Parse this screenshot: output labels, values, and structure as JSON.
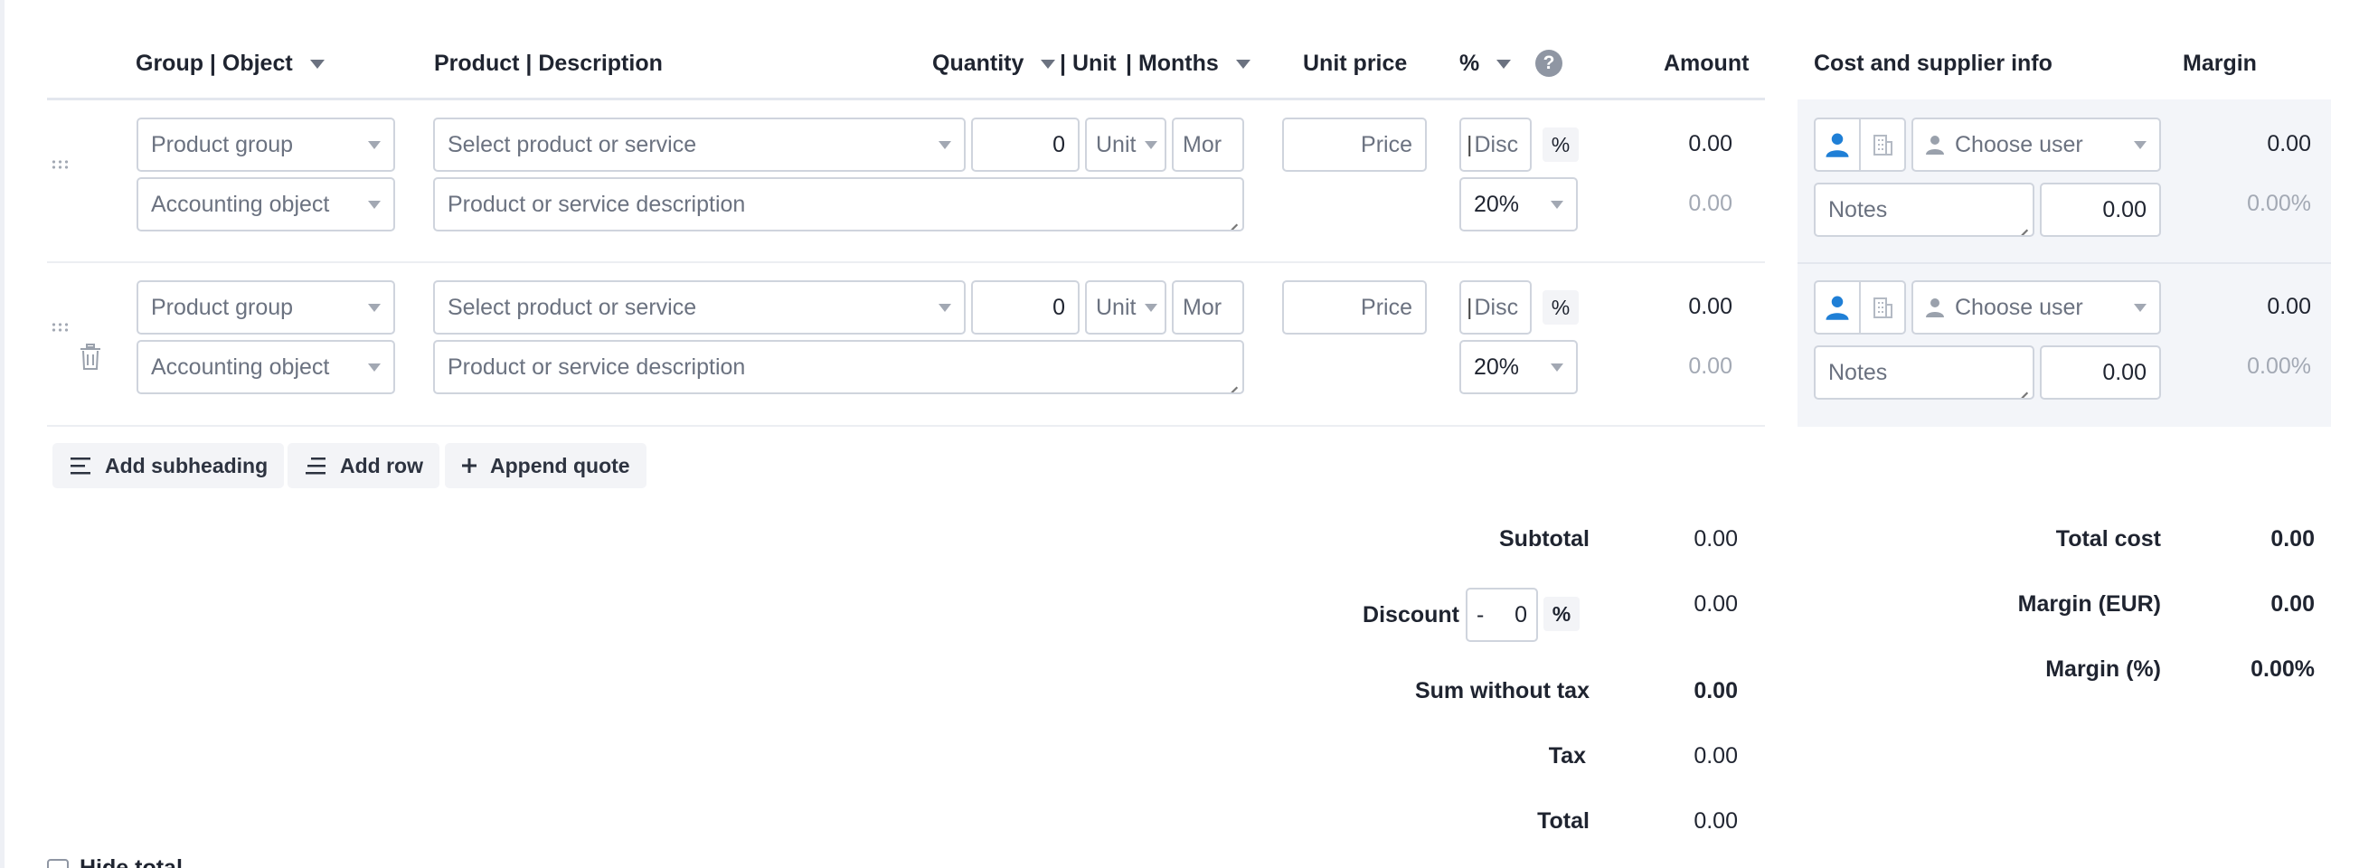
{
  "header": {
    "group_object": "Group | Object",
    "product_description": "Product | Description",
    "quantity": "Quantity",
    "unit": "| Unit",
    "months": "| Months",
    "unit_price": "Unit price",
    "percent": "%",
    "help_glyph": "?",
    "amount": "Amount",
    "cost_supplier": "Cost and supplier info",
    "margin": "Margin"
  },
  "rows": [
    {
      "product_group_placeholder": "Product group",
      "accounting_object_placeholder": "Accounting object",
      "product_placeholder": "Select product or service",
      "description_placeholder": "Product or service description",
      "quantity_value": "0",
      "unit_placeholder": "Unit",
      "months_placeholder": "Mor",
      "price_placeholder": "Price",
      "discount_placeholder": "Disc",
      "percent_button": "%",
      "tax_value": "20%",
      "amount": "0.00",
      "amount_tax": "0.00",
      "user_placeholder": "Choose user",
      "notes_placeholder": "Notes",
      "cost_value": "0.00",
      "margin": "0.00",
      "margin_pct": "0.00%"
    },
    {
      "product_group_placeholder": "Product group",
      "accounting_object_placeholder": "Accounting object",
      "product_placeholder": "Select product or service",
      "description_placeholder": "Product or service description",
      "quantity_value": "0",
      "unit_placeholder": "Unit",
      "months_placeholder": "Mor",
      "price_placeholder": "Price",
      "discount_placeholder": "Disc",
      "percent_button": "%",
      "tax_value": "20%",
      "amount": "0.00",
      "amount_tax": "0.00",
      "user_placeholder": "Choose user",
      "notes_placeholder": "Notes",
      "cost_value": "0.00",
      "margin": "0.00",
      "margin_pct": "0.00%"
    }
  ],
  "actions": {
    "add_subheading": "Add subheading",
    "add_row": "Add row",
    "append_quote": "Append quote"
  },
  "totals": {
    "subtotal_label": "Subtotal",
    "subtotal_value": "0.00",
    "discount_label": "Discount",
    "discount_sign": "-",
    "discount_value": "0",
    "discount_unit": "%",
    "discount_amount": "0.00",
    "sum_without_tax_label": "Sum without tax",
    "sum_without_tax_value": "0.00",
    "tax_label": "Tax",
    "tax_value": "0.00",
    "total_label": "Total",
    "total_value": "0.00"
  },
  "cost_totals": {
    "total_cost_label": "Total cost",
    "total_cost_value": "0.00",
    "margin_eur_label": "Margin (EUR)",
    "margin_eur_value": "0.00",
    "margin_pct_label": "Margin (%)",
    "margin_pct_value": "0.00%"
  },
  "footer": {
    "hide_total_label": "Hide total"
  },
  "colors": {
    "accent_blue": "#1f7fd6",
    "border": "#cfd4dd",
    "muted_text": "#a3a9b4"
  }
}
